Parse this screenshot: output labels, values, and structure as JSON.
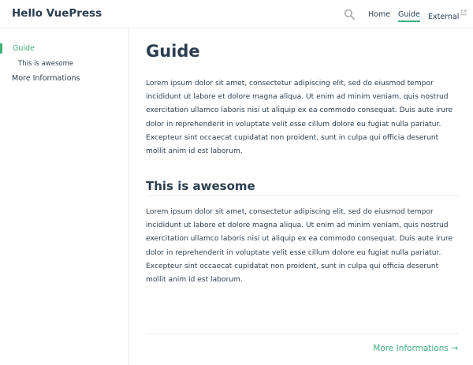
{
  "navbar": {
    "site_name": "Hello VuePress",
    "search_icon": "search-icon",
    "links": {
      "home": "Home",
      "guide": "Guide",
      "external": "External"
    },
    "external_icon": "external-link-icon"
  },
  "sidebar": {
    "items": [
      {
        "label": "Guide",
        "active": true
      },
      {
        "label": "This is awesome",
        "active": false
      },
      {
        "label": "More Informations",
        "active": false
      }
    ]
  },
  "content": {
    "title": "Guide",
    "paragraph1": "Lorem ipsum dolor sit amet, consectetur adipiscing elit, sed do eiusmod tempor incididunt ut labore et dolore magna aliqua. Ut enim ad minim veniam, quis nostrud exercitation ullamco laboris nisi ut aliquip ex ea commodo consequat. Duis aute irure dolor in reprehenderit in voluptate velit esse cillum dolore eu fugiat nulla pariatur. Excepteur sint occaecat cupidatat non proident, sunt in culpa qui officia deserunt mollit anim id est laborum.",
    "section_title": "This is awesome",
    "paragraph2": "Lorem ipsum dolor sit amet, consectetur adipiscing elit, sed do eiusmod tempor incididunt ut labore et dolore magna aliqua. Ut enim ad minim veniam, quis nostrud exercitation ullamco laboris nisi ut aliquip ex ea commodo consequat. Duis aute irure dolor in reprehenderit in voluptate velit esse cillum dolore eu fugiat nulla pariatur. Excepteur sint occaecat cupidatat non proident, sunt in culpa qui officia deserunt mollit anim id est laborum.",
    "next_link": "More Informations →"
  },
  "colors": {
    "accent": "#3eaf7c",
    "text": "#2c3e50",
    "border": "#eaecef"
  }
}
